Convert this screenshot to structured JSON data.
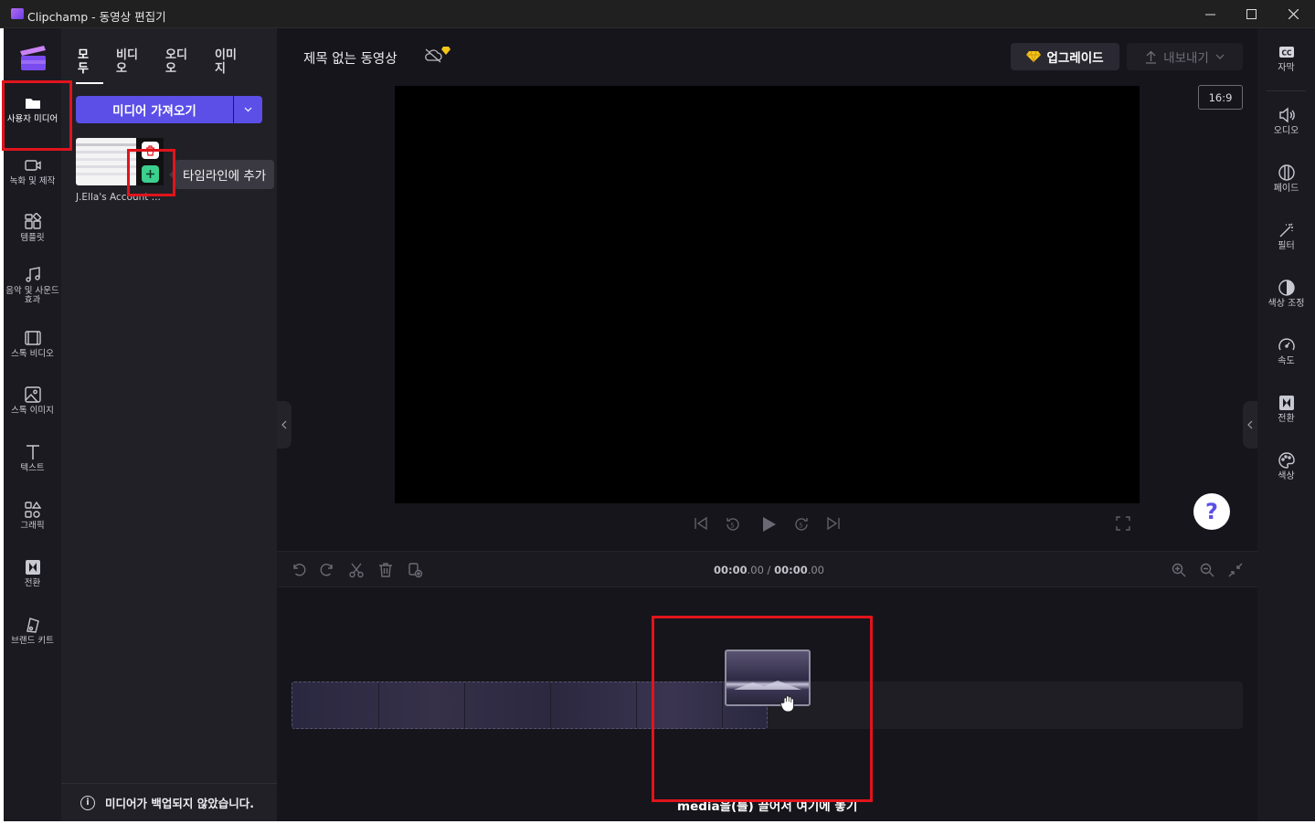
{
  "window": {
    "title": "Clipchamp - 동영상 편집기",
    "minimize_icon": "minimize-icon",
    "maximize_icon": "maximize-icon",
    "close_icon": "close-icon"
  },
  "left_rail": {
    "items": [
      {
        "label": "사용자 미디어",
        "icon": "folder-icon",
        "active": true
      },
      {
        "label": "녹화 및 제작",
        "icon": "camera-icon"
      },
      {
        "label": "템플릿",
        "icon": "template-icon"
      },
      {
        "label": "음악 및 사운드 효과",
        "icon": "music-icon"
      },
      {
        "label": "스톡 비디오",
        "icon": "film-icon"
      },
      {
        "label": "스톡 이미지",
        "icon": "image-icon"
      },
      {
        "label": "텍스트",
        "icon": "text-icon"
      },
      {
        "label": "그래픽",
        "icon": "shapes-icon"
      },
      {
        "label": "전환",
        "icon": "transition-icon"
      },
      {
        "label": "브랜드 키트",
        "icon": "brand-kit-icon"
      }
    ]
  },
  "media_panel": {
    "tabs": [
      {
        "label": "모\n두",
        "active": true
      },
      {
        "label": "비디\n오"
      },
      {
        "label": "오디\n오"
      },
      {
        "label": "이미\n지"
      }
    ],
    "import_button": "미디어 가져오기",
    "tooltip": "타임라인에 추가",
    "media_item_name": "J.Ella's Account ...",
    "backup_notice": "미디어가 백업되지 않았습니다."
  },
  "editor": {
    "project_title": "제목 없는 동영상",
    "upgrade_label": "업그레이드",
    "export_label": "내보내기",
    "aspect_ratio": "16:9",
    "help_label": "?"
  },
  "timeline": {
    "current_time": "00:00",
    "current_time_frac": ".00",
    "separator": " / ",
    "total_time": "00:00",
    "total_time_frac": ".00",
    "drop_hint": "media을(를) 끌어서 여기에 놓기"
  },
  "right_rail": {
    "items": [
      {
        "label": "자막",
        "icon": "captions-icon"
      },
      {
        "label": "오디오",
        "icon": "speaker-icon"
      },
      {
        "label": "페이드",
        "icon": "fade-icon"
      },
      {
        "label": "필터",
        "icon": "magic-wand-icon"
      },
      {
        "label": "색상 조정",
        "icon": "color-adjust-icon"
      },
      {
        "label": "속도",
        "icon": "speedometer-icon"
      },
      {
        "label": "전환",
        "icon": "transition-icon"
      },
      {
        "label": "색상",
        "icon": "palette-icon"
      }
    ]
  },
  "colors": {
    "accent": "#5b4fe8",
    "highlight_box": "#e0141c",
    "add_button": "#3ccf8e",
    "premium_gem": "#f5c518"
  }
}
